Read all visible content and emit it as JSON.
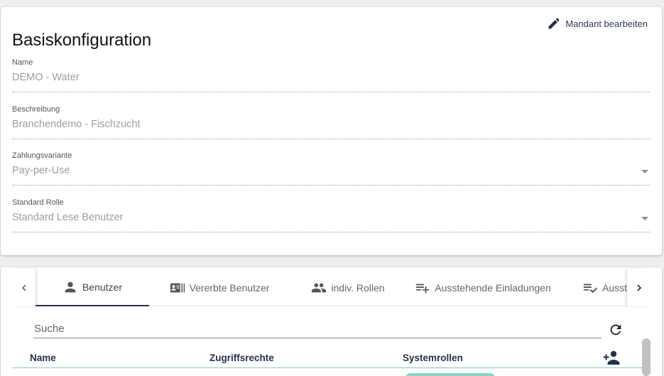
{
  "config": {
    "title": "Basiskonfiguration",
    "edit_label": "Mandant bearbeiten",
    "fields": [
      {
        "label": "Name",
        "value": "DEMO - Water"
      },
      {
        "label": "Beschreibung",
        "value": "Branchendemo - Fischzucht"
      },
      {
        "label": "Zahlungsvariante",
        "value": "Pay-per-Use"
      },
      {
        "label": "Standard Rolle",
        "value": "Standard Lese Benutzer"
      }
    ]
  },
  "tabs": [
    {
      "label": "Benutzer",
      "icon": "person-icon",
      "active": true
    },
    {
      "label": "Vererbte Benutzer",
      "icon": "contact-card-icon",
      "active": false
    },
    {
      "label": "indiv. Rollen",
      "icon": "people-icon",
      "active": false
    },
    {
      "label": "Ausstehende Einladungen",
      "icon": "playlist-add-icon",
      "active": false
    },
    {
      "label": "Ausst",
      "icon": "playlist-check-icon",
      "active": false
    }
  ],
  "search": {
    "placeholder": "Suche"
  },
  "table": {
    "columns": [
      "Name",
      "Zugriffsrechte",
      "Systemrollen"
    ]
  },
  "colors": {
    "primary": "#23304f",
    "accent": "#80cbc4",
    "background": "#eeeeee"
  }
}
